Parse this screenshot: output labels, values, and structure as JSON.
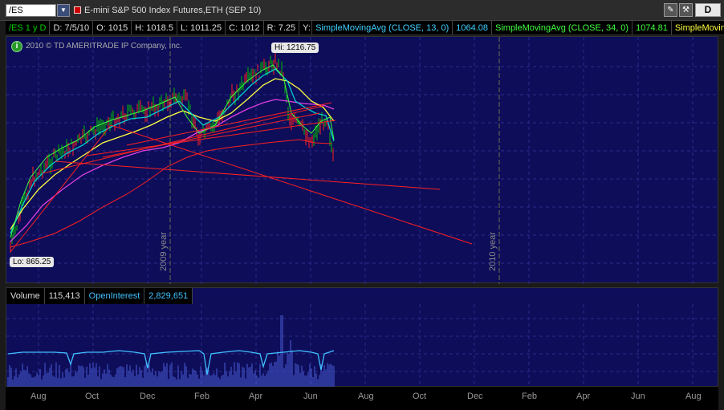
{
  "toolbar": {
    "symbol": "/ES",
    "description": "E-mini S&P 500 Index Futures,ETH (SEP 10)",
    "button_d": "D",
    "icons": [
      "wrench-icon",
      "brush-icon"
    ]
  },
  "infobar": {
    "period": "/ES 1 y D",
    "date": "D: 7/5/10",
    "open": "O: 1015",
    "high": "H: 1018.5",
    "low": "L: 1011.25",
    "close": "C: 1012",
    "range": "R: 7.25",
    "y": "Y:",
    "sma1_label": "SimpleMovingAvg (CLOSE, 13, 0)",
    "sma1_value": "1064.08",
    "sma2_label": "SimpleMovingAvg (CLOSE, 34, 0)",
    "sma2_value": "1074.81",
    "sma3_label": "SimpleMovingAvg"
  },
  "price_panel": {
    "copyright": "2010 © TD AMERITRADE IP Company, Inc.",
    "hi_label": "Hi: 1216.75",
    "lo_label": "Lo: 865.25",
    "year_2009": "2009 year",
    "year_2010": "2010 year"
  },
  "volume_panel": {
    "volume_label": "Volume",
    "volume_value": "115,413",
    "oi_label": "OpenInterest",
    "oi_value": "2,829,651"
  },
  "xaxis": {
    "months": [
      "Aug",
      "Oct",
      "Dec",
      "Feb",
      "Apr",
      "Jun",
      "Aug",
      "Oct",
      "Dec",
      "Feb",
      "Apr",
      "Jun",
      "Aug"
    ]
  },
  "colors": {
    "background": "#0d0d5a",
    "up": "#00c000",
    "down": "#ff2020",
    "sma13": "#00d0d0",
    "sma34": "#ffff40",
    "sma_long": "#e040e0",
    "sma_200": "#ff2020",
    "volume_bars": "#4050c0",
    "open_interest": "#40c0ff"
  }
}
